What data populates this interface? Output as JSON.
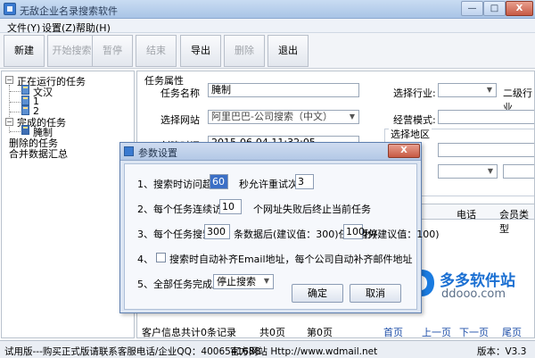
{
  "window": {
    "title": "无敌企业名录搜索软件",
    "minimize": "—",
    "maximize": "□",
    "close": "X"
  },
  "menu": [
    "文件(Y)",
    "设置(Z)",
    "帮助(H)"
  ],
  "toolbar": {
    "buttons": [
      {
        "label": "新建",
        "enabled": true
      },
      {
        "label": "开始搜索",
        "enabled": false
      },
      {
        "label": "暂停",
        "enabled": false
      },
      {
        "label": "结束",
        "enabled": false
      },
      {
        "label": "导出",
        "enabled": true
      },
      {
        "label": "删除",
        "enabled": false
      },
      {
        "label": "退出",
        "enabled": true
      }
    ]
  },
  "tree": {
    "running": "正在运行的任务",
    "running_children": [
      "文汉",
      "1",
      "2"
    ],
    "completed": "完成的任务",
    "completed_children": [
      "腌制"
    ],
    "deleted": "删除的任务",
    "merge": "合并数据汇总"
  },
  "task_props": {
    "group_title": "任务属性",
    "name_label": "任务名称",
    "name_value": "腌制",
    "site_label": "选择网站",
    "site_value": "阿里巴巴-公司搜索（中文）",
    "industry_label": "选择行业:",
    "industry2_label": "二级行业",
    "mode_label": "经营模式:",
    "region_label": "选择地区",
    "hidden_label": "创建时间",
    "hidden_value": "2015-06-04 11:32:05"
  },
  "grid": {
    "columns": [
      "电话",
      "会员类型"
    ]
  },
  "footer": {
    "summary": "客户信息共计0条记录",
    "pages": "共0页",
    "current": "第0页",
    "first": "首页",
    "prev": "上一页",
    "next": "下一页",
    "last": "尾页"
  },
  "statusbar": {
    "trial": "试用版---购买正式版请联系客服电话/企业QQ：4006541688",
    "site": "官方网站 Http://www.wdmail.net",
    "version": "版本：V3.3"
  },
  "dialog": {
    "title": "参数设置",
    "close": "X",
    "row1_a": "1、搜索时访问超时",
    "timeout": "60",
    "row1_b": "秒允许重试次数",
    "retries": "3",
    "row2_a": "2、每个任务连续访问",
    "consecutive": "10",
    "row2_b": "个网址失败后终止当前任务",
    "row3_a": "3、每个任务搜索",
    "batch": "300",
    "row3_b": "条数据后(建议值：300)任务暂停",
    "pause": "100",
    "row3_c": "秒(建议值：100)",
    "row4_num": "4、",
    "row4_text": "搜索时自动补齐Email地址，每个公司自动补齐邮件地址",
    "row4_checked": false,
    "row5_a": "5、全部任务完成后",
    "after_all": "停止搜索",
    "ok": "确定",
    "cancel": "取消"
  },
  "watermark": {
    "brand": "多多软件站",
    "domain": "ddooo.com"
  }
}
